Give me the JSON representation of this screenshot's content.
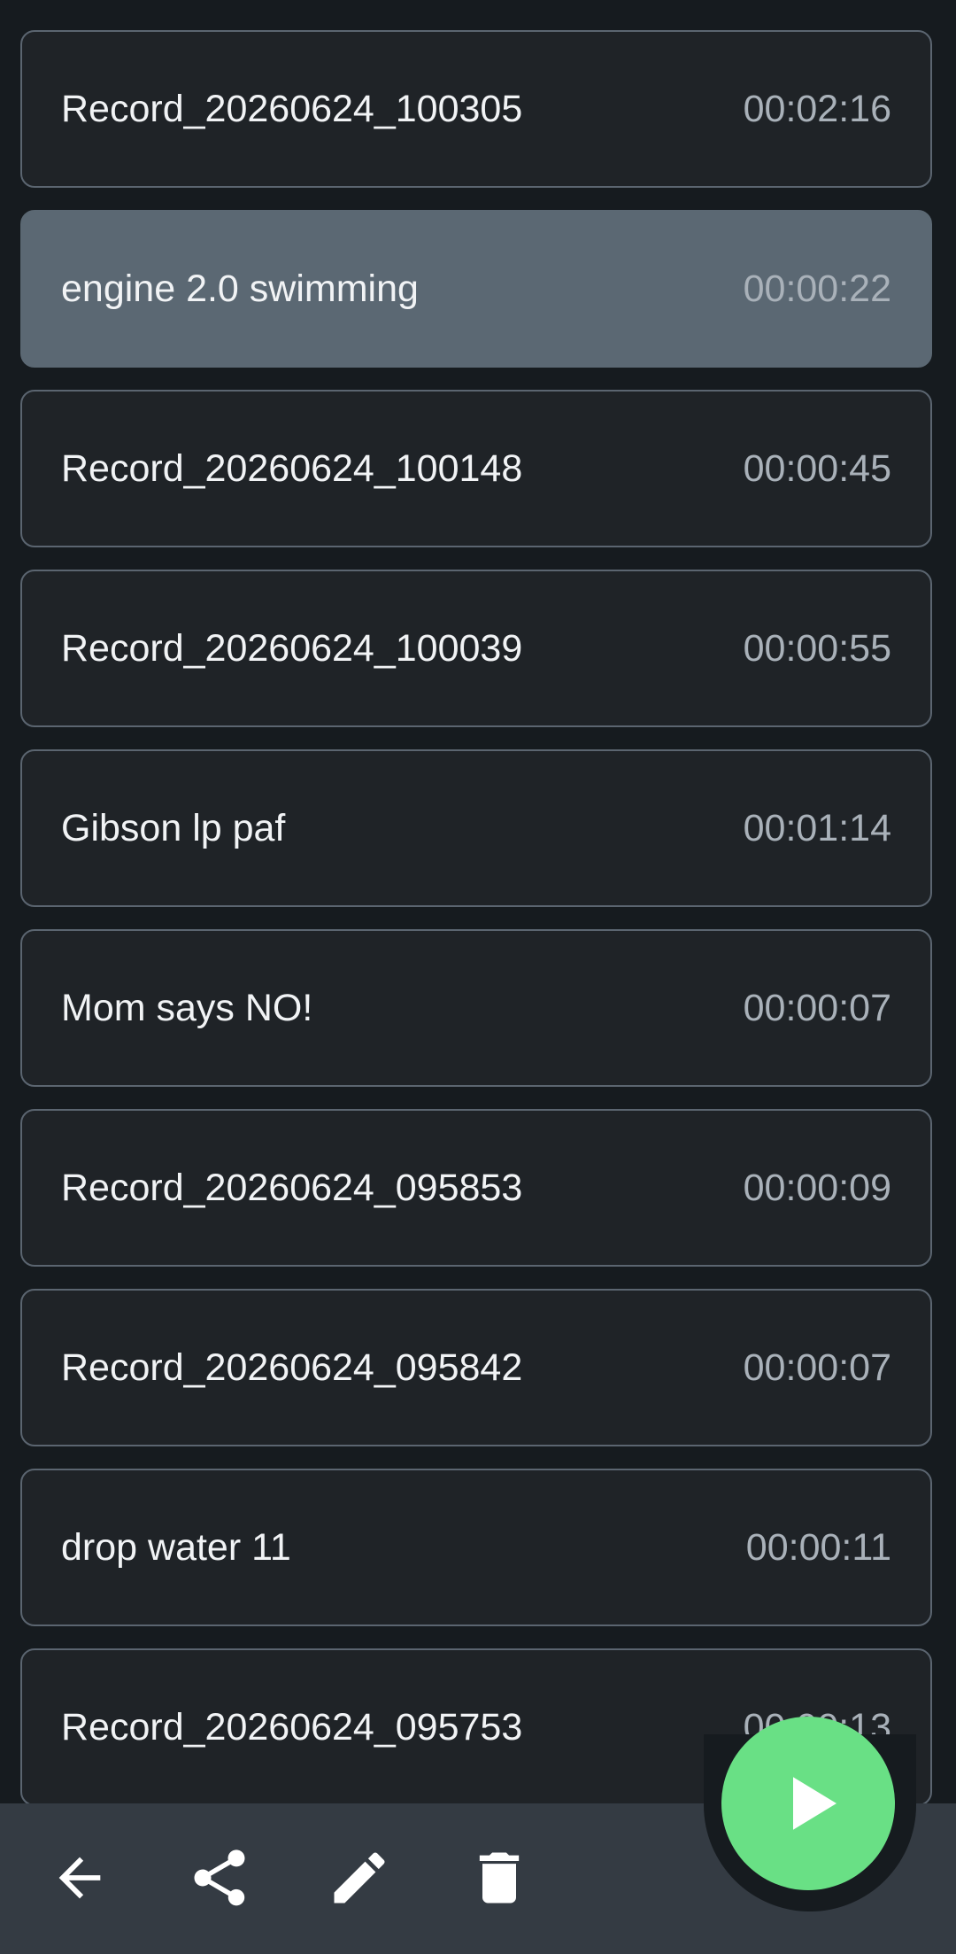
{
  "recordings": [
    {
      "name": "Record_20260624_100305",
      "duration": "00:02:16",
      "selected": false
    },
    {
      "name": "engine 2.0 swimming",
      "duration": "00:00:22",
      "selected": true
    },
    {
      "name": "Record_20260624_100148",
      "duration": "00:00:45",
      "selected": false
    },
    {
      "name": "Record_20260624_100039",
      "duration": "00:00:55",
      "selected": false
    },
    {
      "name": "Gibson lp paf",
      "duration": "00:01:14",
      "selected": false
    },
    {
      "name": "Mom says NO!",
      "duration": "00:00:07",
      "selected": false
    },
    {
      "name": "Record_20260624_095853",
      "duration": "00:00:09",
      "selected": false
    },
    {
      "name": "Record_20260624_095842",
      "duration": "00:00:07",
      "selected": false
    },
    {
      "name": "drop water 11",
      "duration": "00:00:11",
      "selected": false
    },
    {
      "name": "Record_20260624_095753",
      "duration": "00:00:13",
      "selected": false
    }
  ],
  "toolbar": {
    "actions": [
      "back-arrow-icon",
      "share-icon",
      "pencil-icon",
      "trash-icon"
    ],
    "fab_icon": "play-icon"
  },
  "colors": {
    "background": "#161b1f",
    "row_background": "#1f2327",
    "row_selected": "#5b6873",
    "row_border": "#5b6570",
    "bottom_bar": "#343b43",
    "fab": "#69e085",
    "text_primary": "#f1f3f5",
    "text_secondary": "#a9b1b9"
  }
}
